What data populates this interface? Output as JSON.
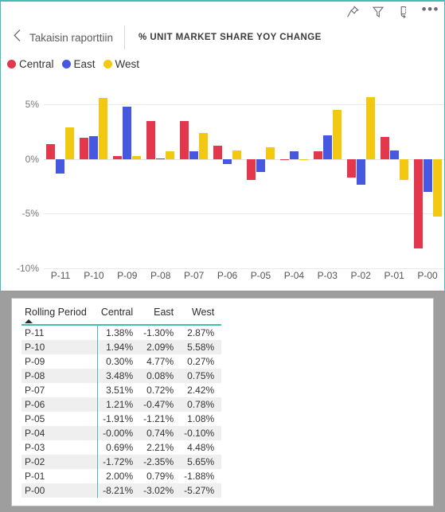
{
  "toolbar": {
    "pin_icon": "pin-icon",
    "filter_icon": "filter-icon",
    "focus_icon": "focus-mode-icon",
    "more_label": "•••"
  },
  "header": {
    "back_label": "Takaisin raporttiin",
    "title": "% UNIT MARKET SHARE YOY CHANGE"
  },
  "colors": {
    "central": "#E2374D",
    "east": "#4758E0",
    "west": "#F2C811",
    "accent_teal": "#41BFB7",
    "gridline": "#EAEAEA",
    "panel_background": "#FFFFFF",
    "page_background": "#9E9E9E"
  },
  "legend": {
    "items": [
      {
        "label": "Central",
        "color": "#E2374D"
      },
      {
        "label": "East",
        "color": "#4758E0"
      },
      {
        "label": "West",
        "color": "#F2C811"
      }
    ]
  },
  "chart_data": {
    "type": "bar",
    "title": "% UNIT MARKET SHARE YOY CHANGE",
    "xlabel": "",
    "ylabel": "",
    "ylim": [
      -10,
      7.5
    ],
    "yticks": [
      5,
      0,
      -5,
      -10
    ],
    "ytick_labels": [
      "5%",
      "0%",
      "-5%",
      "-10%"
    ],
    "grid": true,
    "legend_position": "top-left",
    "categories": [
      "P-11",
      "P-10",
      "P-09",
      "P-08",
      "P-07",
      "P-06",
      "P-05",
      "P-04",
      "P-03",
      "P-02",
      "P-01",
      "P-00"
    ],
    "series": [
      {
        "name": "Central",
        "color": "#E2374D",
        "values": [
          1.38,
          1.94,
          0.3,
          3.48,
          3.51,
          1.21,
          -1.91,
          -0.0,
          0.69,
          -1.72,
          2.0,
          -8.21
        ]
      },
      {
        "name": "East",
        "color": "#4758E0",
        "values": [
          -1.3,
          2.09,
          4.77,
          0.08,
          0.72,
          -0.47,
          -1.21,
          0.74,
          2.21,
          -2.35,
          0.79,
          -3.02
        ]
      },
      {
        "name": "West",
        "color": "#F2C811",
        "values": [
          2.87,
          5.58,
          0.27,
          0.75,
          2.42,
          0.78,
          1.08,
          -0.1,
          4.48,
          5.65,
          -1.88,
          -5.27
        ]
      }
    ]
  },
  "table": {
    "columns": [
      "Rolling Period",
      "Central",
      "East",
      "West"
    ],
    "sort_column": "Rolling Period",
    "sort_direction": "ascending",
    "rows": [
      {
        "period": "P-11",
        "central": "1.38%",
        "east": "-1.30%",
        "west": "2.87%"
      },
      {
        "period": "P-10",
        "central": "1.94%",
        "east": "2.09%",
        "west": "5.58%"
      },
      {
        "period": "P-09",
        "central": "0.30%",
        "east": "4.77%",
        "west": "0.27%"
      },
      {
        "period": "P-08",
        "central": "3.48%",
        "east": "0.08%",
        "west": "0.75%"
      },
      {
        "period": "P-07",
        "central": "3.51%",
        "east": "0.72%",
        "west": "2.42%"
      },
      {
        "period": "P-06",
        "central": "1.21%",
        "east": "-0.47%",
        "west": "0.78%"
      },
      {
        "period": "P-05",
        "central": "-1.91%",
        "east": "-1.21%",
        "west": "1.08%"
      },
      {
        "period": "P-04",
        "central": "-0.00%",
        "east": "0.74%",
        "west": "-0.10%"
      },
      {
        "period": "P-03",
        "central": "0.69%",
        "east": "2.21%",
        "west": "4.48%"
      },
      {
        "period": "P-02",
        "central": "-1.72%",
        "east": "-2.35%",
        "west": "5.65%"
      },
      {
        "period": "P-01",
        "central": "2.00%",
        "east": "0.79%",
        "west": "-1.88%"
      },
      {
        "period": "P-00",
        "central": "-8.21%",
        "east": "-3.02%",
        "west": "-5.27%"
      }
    ]
  }
}
